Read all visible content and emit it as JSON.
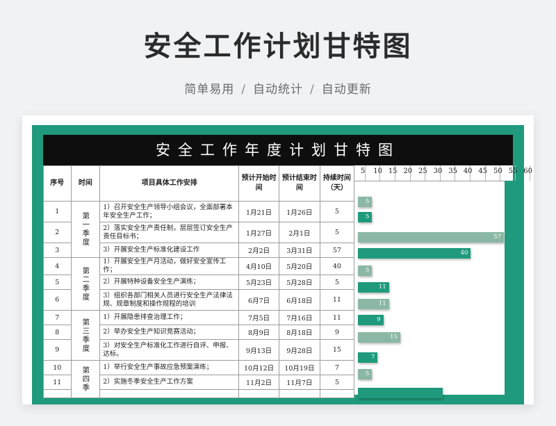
{
  "header": {
    "title": "安全工作计划甘特图",
    "subtitle_parts": [
      "简单易用",
      "自动统计",
      "自动更新"
    ],
    "separator": "/"
  },
  "sheet": {
    "title": "安全工作年度计划甘特图",
    "columns": [
      "序号",
      "时间",
      "项目具体工作安排",
      "预计开始时间",
      "预计结束时间",
      "持续时间（天）"
    ],
    "quarters": [
      "第一季度",
      "第二季度",
      "第三季度",
      "第四季"
    ],
    "rows": [
      {
        "no": "1",
        "task": "1）召开安全生产领导小组会议，全面部署本年安全生产工作；",
        "start": "1月21日",
        "end": "1月26日",
        "days": "5"
      },
      {
        "no": "2",
        "task": "2）落实安全生产责任制，层层签订安全生产责任目标书；",
        "start": "1月27日",
        "end": "2月1日",
        "days": "5"
      },
      {
        "no": "3",
        "task": "3）开展安全生产标准化建设工作",
        "start": "2月2日",
        "end": "3月31日",
        "days": "57"
      },
      {
        "no": "4",
        "task": "1）开展安全生产月活动，做好安全宣传工作；",
        "start": "4月10日",
        "end": "5月20日",
        "days": "40"
      },
      {
        "no": "5",
        "task": "2）开展特种设备安全生产演练；",
        "start": "5月23日",
        "end": "5月28日",
        "days": "5"
      },
      {
        "no": "6",
        "task": "3）组织各部门相关人员进行安全生产法律法规、规章制度和操作规程的培训",
        "start": "6月7日",
        "end": "6月18日",
        "days": "11"
      },
      {
        "no": "7",
        "task": "1）开展隐患排查治理工作；",
        "start": "7月5日",
        "end": "7月16日",
        "days": "11"
      },
      {
        "no": "8",
        "task": "2）举办安全生产知识竞赛活动；",
        "start": "8月9日",
        "end": "8月18日",
        "days": "9"
      },
      {
        "no": "9",
        "task": "3）对安全生产标准化工作进行自评、申报、达标。",
        "start": "9月13日",
        "end": "9月28日",
        "days": "15"
      },
      {
        "no": "10",
        "task": "1）举行安全生产事故应急预案演练；",
        "start": "10月12日",
        "end": "10月19日",
        "days": "7"
      },
      {
        "no": "11",
        "task": "2）实施冬季安全生产工作方案",
        "start": "11月2日",
        "end": "11月7日",
        "days": "5"
      }
    ]
  },
  "gantt": {
    "axis_ticks": [
      "5",
      "10",
      "15",
      "20",
      "25",
      "30",
      "35",
      "40",
      "45",
      "50",
      "55",
      "60"
    ],
    "durations": [
      5,
      5,
      57,
      40,
      5,
      11,
      11,
      9,
      15,
      7,
      5,
      30
    ],
    "bar_labels": [
      "5",
      "5",
      "57",
      "40",
      "5",
      "11",
      "11",
      "9",
      "15",
      "7",
      "5",
      ""
    ],
    "colors": {
      "dark": "#1f9a7c",
      "light": "#8ab8a4"
    }
  }
}
